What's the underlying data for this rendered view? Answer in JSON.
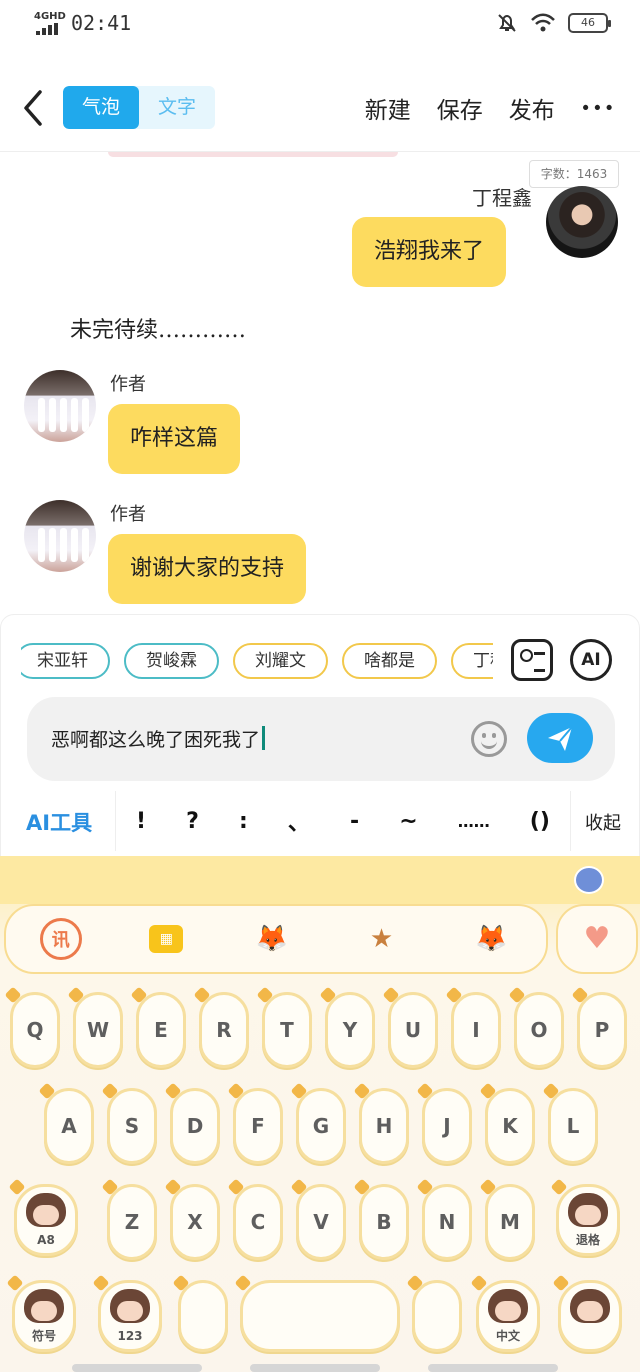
{
  "status_bar": {
    "network": "4GHD",
    "time": "02:41",
    "battery": "46"
  },
  "header": {
    "tabs": [
      {
        "label": "气泡",
        "active": true
      },
      {
        "label": "文字",
        "active": false
      }
    ],
    "actions": {
      "new": "新建",
      "save": "保存",
      "publish": "发布"
    }
  },
  "chat": {
    "word_count": "字数：1463",
    "messages": [
      {
        "sender": "丁程鑫",
        "side": "right",
        "text": "浩翔我来了"
      },
      {
        "type": "narration",
        "text": "未完待续…………"
      },
      {
        "sender": "作者",
        "side": "left",
        "text": "咋样这篇"
      },
      {
        "sender": "作者",
        "side": "left",
        "text": "谢谢大家的支持"
      }
    ]
  },
  "character_chips": [
    "宋亚轩",
    "贺峻霖",
    "刘耀文",
    "啥都是",
    "丁程鑫"
  ],
  "input": {
    "value": "恶啊都这么晚了困死我了",
    "ai_button": "AI"
  },
  "tools": {
    "ai_tools_label": "AI工具",
    "punctuation": [
      "!",
      "?",
      ":",
      "、",
      "-",
      "~",
      "……",
      "()"
    ],
    "collapse": "收起"
  },
  "keyboard": {
    "row1": [
      "Q",
      "W",
      "E",
      "R",
      "T",
      "Y",
      "U",
      "I",
      "O",
      "P"
    ],
    "row2": [
      "A",
      "S",
      "D",
      "F",
      "G",
      "H",
      "J",
      "K",
      "L"
    ],
    "row3": [
      "Z",
      "X",
      "C",
      "V",
      "B",
      "N",
      "M"
    ],
    "shift_label": "A8",
    "delete_label": "退格",
    "symbol_label": "符号",
    "number_label": "123",
    "lang_label": "中文",
    "toolbar_icons": [
      "xunfei-icon",
      "keyboard-icon",
      "fox-icon",
      "cookie-icon",
      "fox-face-icon"
    ]
  },
  "colors": {
    "accent": "#20a9ec",
    "bubble": "#fddb5f",
    "keyboard_border": "#f6df9f"
  }
}
